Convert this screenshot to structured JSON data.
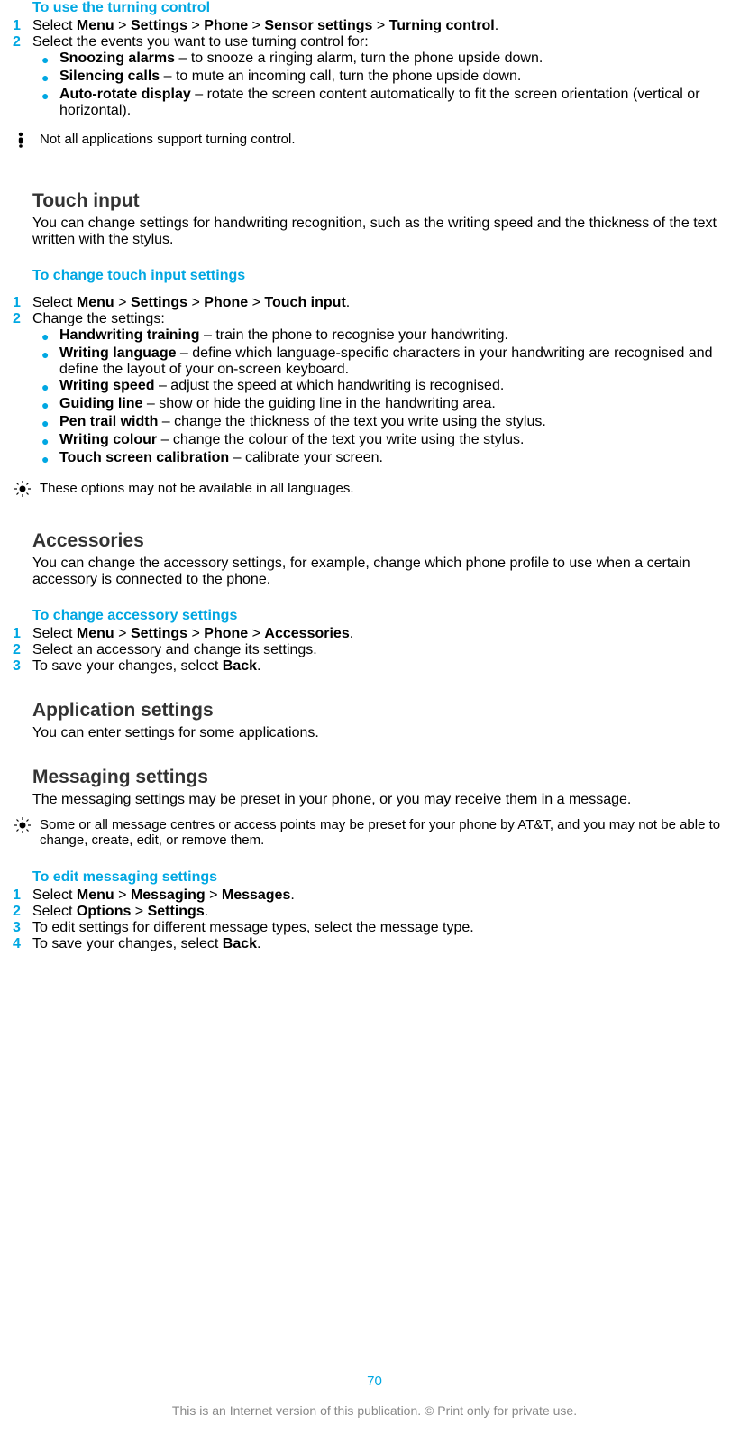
{
  "s1": {
    "title": "To use the turning control",
    "step1": {
      "pre": "Select ",
      "m": "Menu",
      "g1": " > ",
      "set": "Settings",
      "g2": " > ",
      "ph": "Phone",
      "g3": " > ",
      "ss": "Sensor settings",
      "g4": " > ",
      "tc": "Turning control",
      "end": "."
    },
    "step2": "Select the events you want to use turning control for:",
    "b1": {
      "h": "Snoozing alarms",
      "t": " – to snooze a ringing alarm, turn the phone upside down."
    },
    "b2": {
      "h": "Silencing calls",
      "t": " – to mute an incoming call, turn the phone upside down."
    },
    "b3": {
      "h": "Auto-rotate display",
      "t": " – rotate the screen content automatically to fit the screen orientation (vertical or horizontal)."
    },
    "note": "Not all applications support turning control."
  },
  "s2": {
    "heading": "Touch input",
    "para": "You can change settings for handwriting recognition, such as the writing speed and the thickness of the text written with the stylus.",
    "title": "To change touch input settings",
    "step1": {
      "pre": "Select ",
      "m": "Menu",
      "g1": " > ",
      "set": "Settings",
      "g2": " > ",
      "ph": "Phone",
      "g3": " > ",
      "ti": "Touch input",
      "end": "."
    },
    "step2": "Change the settings:",
    "b1": {
      "h": "Handwriting training",
      "t": " – train the phone to recognise your handwriting."
    },
    "b2": {
      "h": "Writing language",
      "t": " – define which language-specific characters in your handwriting are recognised and define the layout of your on-screen keyboard."
    },
    "b3": {
      "h": "Writing speed",
      "t": " – adjust the speed at which handwriting is recognised."
    },
    "b4": {
      "h": "Guiding line",
      "t": " – show or hide the guiding line in the handwriting area."
    },
    "b5": {
      "h": "Pen trail width",
      "t": " – change the thickness of the text you write using the stylus."
    },
    "b6": {
      "h": "Writing colour",
      "t": " – change the colour of the text you write using the stylus."
    },
    "b7": {
      "h": "Touch screen calibration",
      "t": " – calibrate your screen."
    },
    "note": "These options may not be available in all languages."
  },
  "s3": {
    "heading": "Accessories",
    "para": "You can change the accessory settings, for example, change which phone profile to use when a certain accessory is connected to the phone.",
    "title": "To change accessory settings",
    "step1": {
      "pre": "Select ",
      "m": "Menu",
      "g1": " > ",
      "set": "Settings",
      "g2": " > ",
      "ph": "Phone",
      "g3": " > ",
      "acc": "Accessories",
      "end": "."
    },
    "step2": "Select an accessory and change its settings.",
    "step3": {
      "pre": "To save your changes, select ",
      "b": "Back",
      "end": "."
    }
  },
  "s4": {
    "heading": "Application settings",
    "para": "You can enter settings for some applications."
  },
  "s5": {
    "heading": "Messaging settings",
    "para": "The messaging settings may be preset in your phone, or you may receive them in a message.",
    "note": "Some or all message centres or access points may be preset for your phone by AT&T, and you may not be able to change, create, edit, or remove them.",
    "title": "To edit messaging settings",
    "step1": {
      "pre": "Select ",
      "m": "Menu",
      "g1": " > ",
      "msg": "Messaging",
      "g2": " > ",
      "msgs": "Messages",
      "end": "."
    },
    "step2": {
      "pre": "Select ",
      "o": "Options",
      "g1": " > ",
      "s": "Settings",
      "end": "."
    },
    "step3": "To edit settings for different message types, select the message type.",
    "step4": {
      "pre": "To save your changes, select ",
      "b": "Back",
      "end": "."
    }
  },
  "pagenum": "70",
  "footer": "This is an Internet version of this publication. © Print only for private use."
}
